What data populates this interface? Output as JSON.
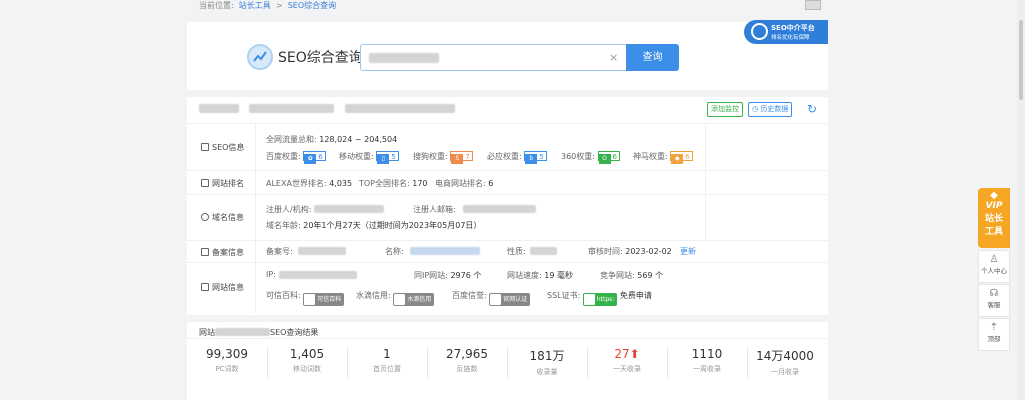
{
  "breadcrumb": {
    "prefix": "当前位置:",
    "home": "站长工具",
    "sep": ">",
    "current": "SEO综合查询"
  },
  "search": {
    "title": "SEO综合查询",
    "clear": "×",
    "button": "查询"
  },
  "promo": {
    "line1": "SEO中介平台",
    "line2": "排名优化有保障"
  },
  "actions": {
    "add_monitor": "添加监控",
    "history": "历史数据",
    "refresh_icon": "refresh-icon"
  },
  "seo_info": {
    "label": "SEO信息",
    "traffic_label": "全网流量总和:",
    "traffic_value": "128,024 ~ 204,504",
    "weights": [
      {
        "name": "百度权重:",
        "value": "6",
        "color": "#3d8ee8"
      },
      {
        "name": "移动权重:",
        "value": "5",
        "color": "#3d8ee8"
      },
      {
        "name": "搜狗权重:",
        "value": "7",
        "color": "#f08a4b"
      },
      {
        "name": "必应权重:",
        "value": "5",
        "color": "#3d8ee8"
      },
      {
        "name": "360权重:",
        "value": "6",
        "color": "#36b24a"
      },
      {
        "name": "神马权重:",
        "value": "6",
        "color": "#f0a33c"
      }
    ]
  },
  "site_rank": {
    "label": "网站排名",
    "alexa_label": "ALEXA世界排名:",
    "alexa_value": "4,035",
    "top_label": "TOP全国排名:",
    "top_value": "170",
    "ecommerce_label": "电商网站排名:",
    "ecommerce_value": "6"
  },
  "domain_info": {
    "label": "域名信息",
    "registrant_label": "注册人/机构:",
    "email_label": "注册人邮箱:",
    "age_label": "域名年龄:",
    "age_value": "20年1个月27天（过期时间为2023年05月07日）"
  },
  "icp_info": {
    "label": "备案信息",
    "number_label": "备案号:",
    "name_label": "名称:",
    "type_label": "性质:",
    "audit_label": "审核时间:",
    "audit_value": "2023-02-02",
    "update": "更新"
  },
  "site_info": {
    "label": "网站信息",
    "ip_label": "IP:",
    "same_ip_label": "同IP网站:",
    "same_ip_value": "2976 个",
    "speed_label": "网站速度:",
    "speed_value": "19 毫秒",
    "competitor_label": "竞争网站:",
    "competitor_value": "569 个",
    "trust_baike_label": "可信百科:",
    "trust_baike_badge": "可信百科",
    "water_label": "水滴信用:",
    "water_badge": "水滴信用",
    "baidu_trust_label": "百度信誉:",
    "baidu_trust_badge": "官网认证",
    "ssl_label": "SSL证书:",
    "ssl_badge": "https:",
    "ssl_apply": "免费申请"
  },
  "results": {
    "header_prefix": "网站",
    "header_suffix": "SEO查询结果",
    "stats": [
      {
        "value": "99,309",
        "label": "PC词数"
      },
      {
        "value": "1,405",
        "label": "移动词数"
      },
      {
        "value": "1",
        "label": "首页位置"
      },
      {
        "value": "27,965",
        "label": "反链数"
      },
      {
        "value": "181万",
        "label": "收录量"
      },
      {
        "value": "27⬆",
        "label": "一天收录"
      },
      {
        "value": "1110",
        "label": "一周收录"
      },
      {
        "value": "14万4000",
        "label": "一月收录"
      }
    ]
  },
  "side": {
    "vip_line1": "VIP",
    "vip_line2": "站长",
    "vip_line3": "工具",
    "personal": "个人中心",
    "service": "客服",
    "top": "顶部"
  },
  "colors": {
    "accent": "#3d8ee8",
    "green": "#36b24a",
    "orange": "#f5a623",
    "red": "#e5412d"
  }
}
